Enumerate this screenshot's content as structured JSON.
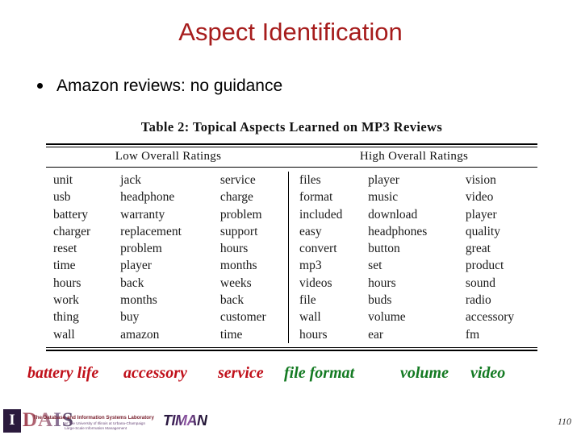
{
  "slide": {
    "title": "Aspect Identification",
    "title_color": "#A61C1C",
    "page_number": "110"
  },
  "bullet": {
    "text": "Amazon reviews: no guidance"
  },
  "table": {
    "caption": "Table 2:  Topical Aspects Learned on MP3 Reviews",
    "group_headers": [
      "Low Overall Ratings",
      "High Overall Ratings"
    ],
    "columns": [
      [
        "unit",
        "usb",
        "battery",
        "charger",
        "reset",
        "time",
        "hours",
        "work",
        "thing",
        "wall"
      ],
      [
        "jack",
        "headphone",
        "warranty",
        "replacement",
        "problem",
        "player",
        "back",
        "months",
        "buy",
        "amazon"
      ],
      [
        "service",
        "charge",
        "problem",
        "support",
        "hours",
        "months",
        "weeks",
        "back",
        "customer",
        "time"
      ],
      [
        "files",
        "format",
        "included",
        "easy",
        "convert",
        "mp3",
        "videos",
        "file",
        "wall",
        "hours"
      ],
      [
        "player",
        "music",
        "download",
        "headphones",
        "button",
        "set",
        "hours",
        "buds",
        "volume",
        "ear"
      ],
      [
        "vision",
        "video",
        "player",
        "quality",
        "great",
        "product",
        "sound",
        "radio",
        "accessory",
        "fm"
      ]
    ]
  },
  "aspect_labels": {
    "color_low": "#C0111B",
    "color_high": "#137A22",
    "items": [
      {
        "text": "battery life",
        "color": "#C0111B"
      },
      {
        "text": "accessory",
        "color": "#C0111B"
      },
      {
        "text": "service",
        "color": "#C0111B"
      },
      {
        "text": "file format",
        "color": "#137A22"
      },
      {
        "text": "volume",
        "color": "#137A22"
      },
      {
        "text": "video",
        "color": "#137A22"
      }
    ]
  },
  "logos": {
    "dais": {
      "initial": "I",
      "wordmark": "DAIS",
      "tagline": "The Database and Information Systems Laboratory",
      "subline_1": "at The University of Illinois at Urbana-Champaign",
      "subline_2": "Large-Scale Information Management"
    },
    "timan": {
      "wordmark": "TIMAN"
    }
  }
}
